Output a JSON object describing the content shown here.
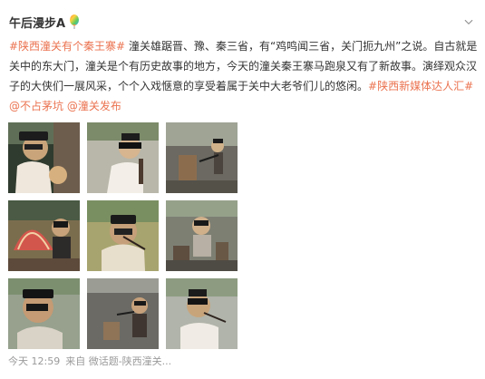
{
  "post": {
    "author": "午后漫步A",
    "text": {
      "tag_1": "#陕西潼关有个秦王寨#",
      "segment_1": " 潼关雄踞晋、豫、秦三省，有“鸡鸣闻三省，关门扼九州”之说。自古就是关中的东大门，潼关是个有历史故事的地方，今天的潼关秦王寨马跑泉又有了新故事。演绎观众汉子的大侠们一展风采，个个入戏惬意的享受着属于关中大老爷们儿的悠闲。",
      "tag_2": "#陕西新媒体达人汇#",
      "mention_1": "@不占茅坑",
      "mention_2": "@潼关发布"
    },
    "footer": {
      "time": "今天 12:59",
      "source": "来自 微话题-陕西潼关..."
    },
    "colors": {
      "link": "#eb7350",
      "text": "#333333",
      "meta": "#9a9a9a"
    }
  },
  "icons": {
    "balloon": "balloon-icon",
    "chevron": "chevron-down-icon"
  }
}
